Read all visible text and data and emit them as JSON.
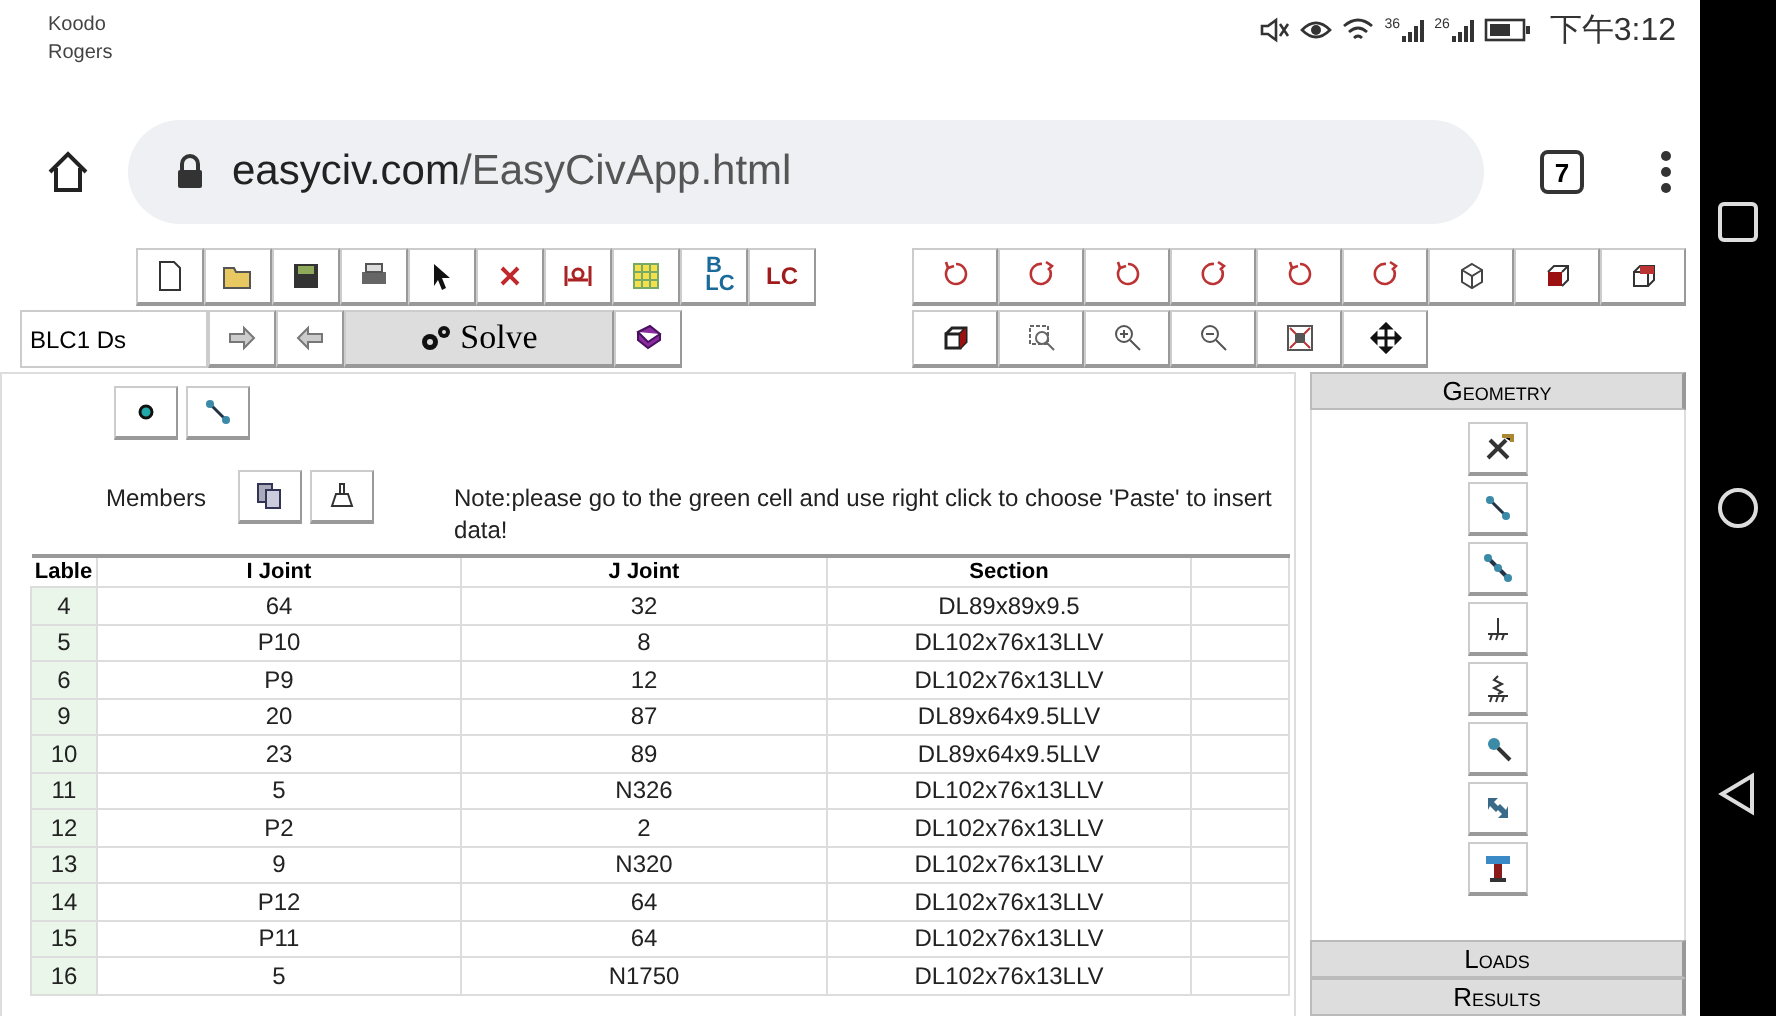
{
  "status_bar": {
    "carriers": [
      "Koodo",
      "Rogers"
    ],
    "signal_labels": [
      "36",
      "26"
    ],
    "time": "下午3:12"
  },
  "browser": {
    "url_host": "easyciv.com",
    "url_path": "/EasyCivApp.html",
    "tab_count": "7"
  },
  "toolbar": {
    "bc_button": {
      "top": "B",
      "bottom": "LC"
    },
    "lc_button": "LC",
    "load_case_field": "BLC1 Ds",
    "solve_button": "Solve"
  },
  "members": {
    "label": "Members",
    "note": "Note:please go to the green cell and use right click to choose 'Paste' to insert data!"
  },
  "table": {
    "columns": [
      "Lable",
      "I Joint",
      "J Joint",
      "Section"
    ],
    "rows": [
      [
        "4",
        "64",
        "32",
        "DL89x89x9.5"
      ],
      [
        "5",
        "P10",
        "8",
        "DL102x76x13LLV"
      ],
      [
        "6",
        "P9",
        "12",
        "DL102x76x13LLV"
      ],
      [
        "9",
        "20",
        "87",
        "DL89x64x9.5LLV"
      ],
      [
        "10",
        "23",
        "89",
        "DL89x64x9.5LLV"
      ],
      [
        "11",
        "5",
        "N326",
        "DL102x76x13LLV"
      ],
      [
        "12",
        "P2",
        "2",
        "DL102x76x13LLV"
      ],
      [
        "13",
        "9",
        "N320",
        "DL102x76x13LLV"
      ],
      [
        "14",
        "P12",
        "64",
        "DL102x76x13LLV"
      ],
      [
        "15",
        "P11",
        "64",
        "DL102x76x13LLV"
      ],
      [
        "16",
        "5",
        "N1750",
        "DL102x76x13LLV"
      ]
    ]
  },
  "side_panel": {
    "sections": [
      {
        "label": "Geometry",
        "expanded": true
      },
      {
        "label": "Loads",
        "expanded": false
      },
      {
        "label": "Results",
        "expanded": false
      }
    ]
  }
}
